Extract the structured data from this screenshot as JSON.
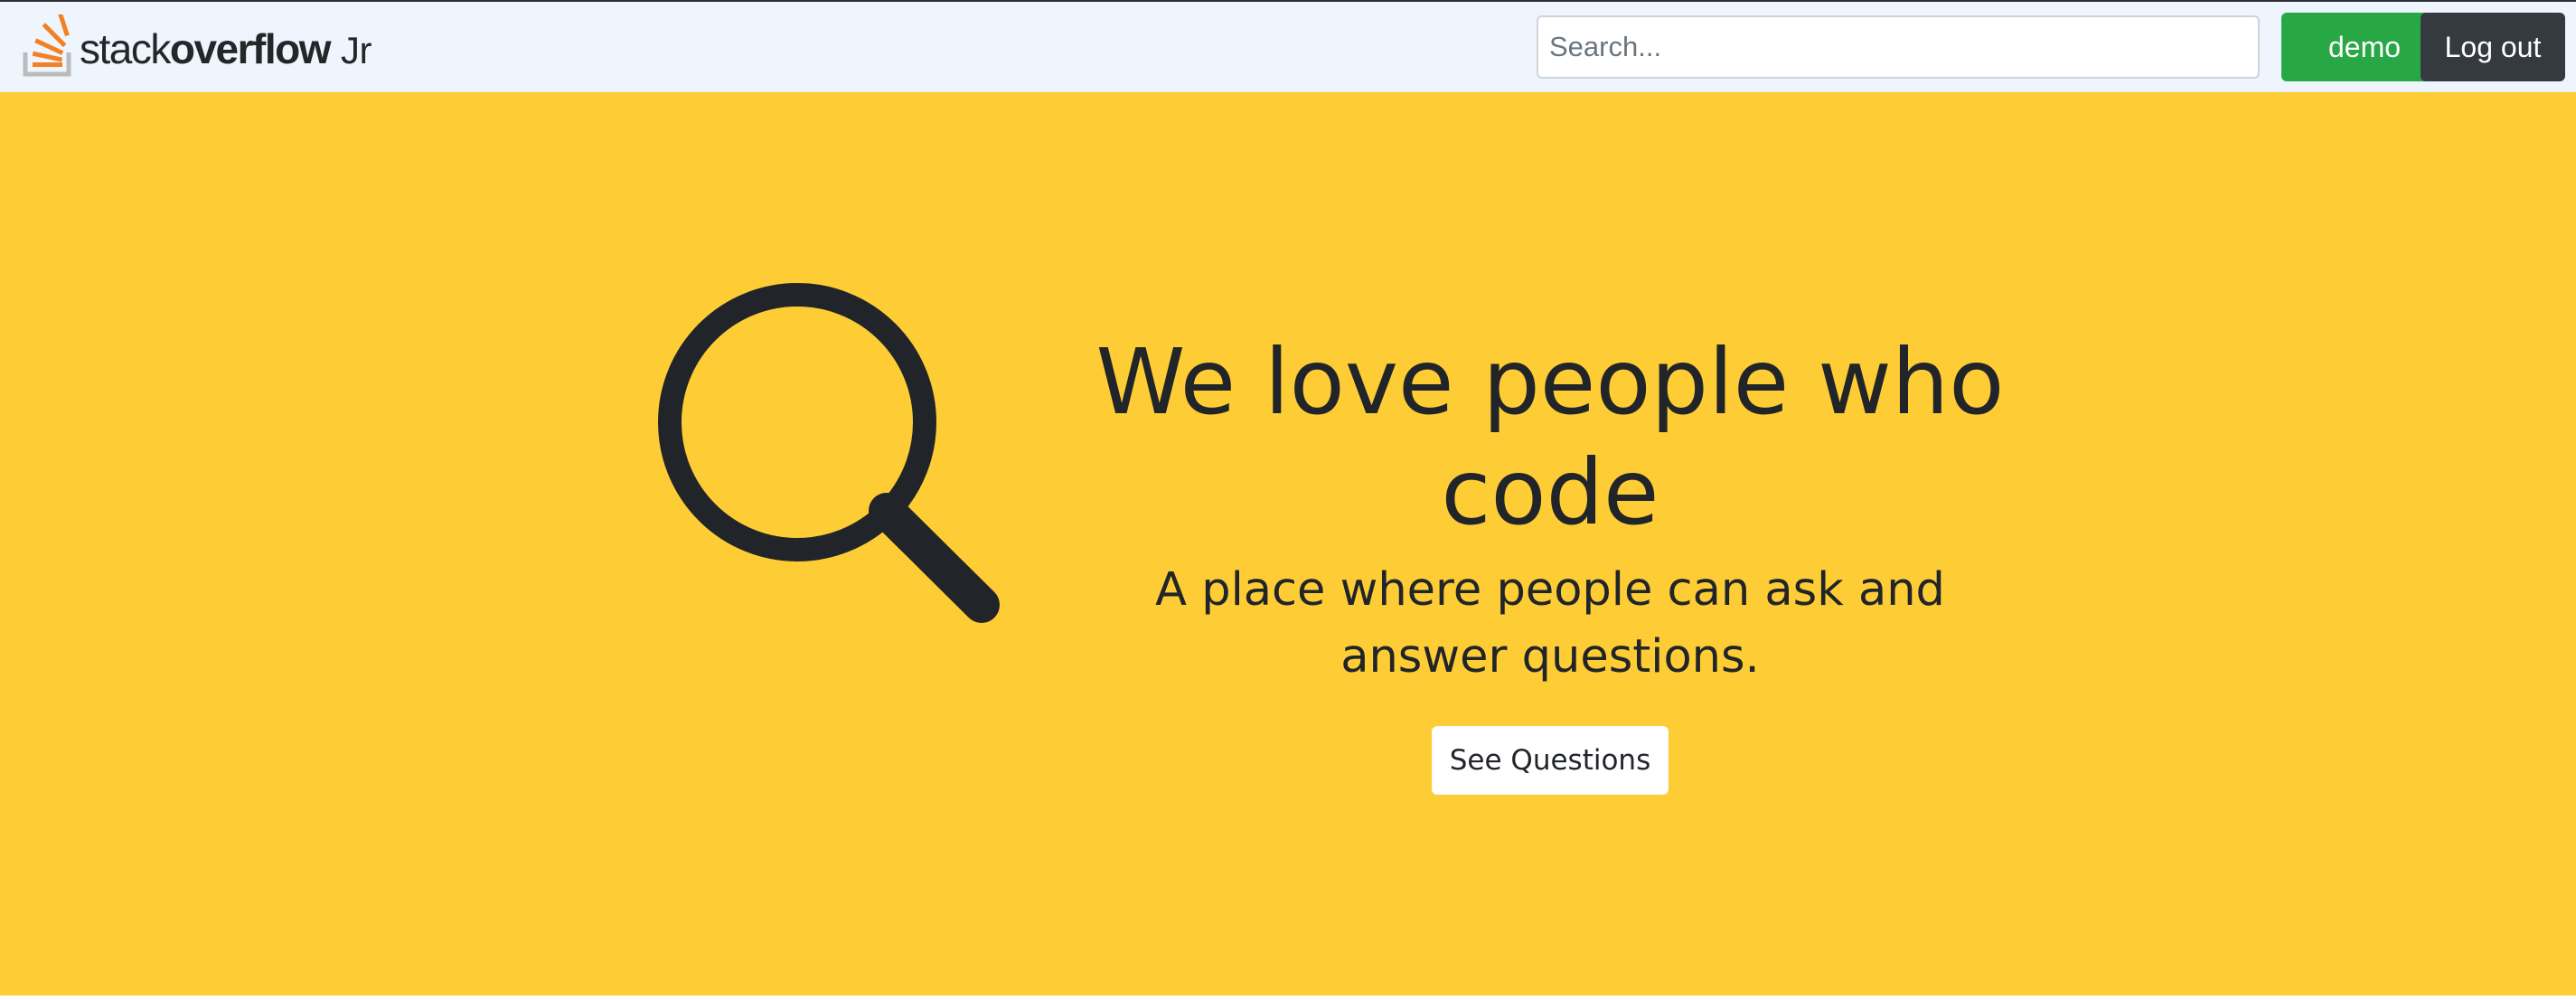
{
  "navbar": {
    "brand": {
      "light": "stack",
      "bold": "overflow",
      "suffix": "Jr",
      "icon": "stackoverflow-logo-icon"
    },
    "search": {
      "placeholder": "Search..."
    },
    "user_button_label": "demo",
    "logout_button_label": "Log out"
  },
  "hero": {
    "icon": "magnifying-glass-icon",
    "title": "We love people who code",
    "subtitle": "A place where people can ask and answer questions.",
    "cta_label": "See Questions"
  },
  "colors": {
    "navbar_bg": "#eef5fd",
    "hero_bg": "#fecd35",
    "demo_button": "#28a745",
    "logout_button": "#343a40",
    "text_dark": "#212529",
    "logo_orange": "#f48024",
    "logo_gray": "#bcbbbb"
  }
}
